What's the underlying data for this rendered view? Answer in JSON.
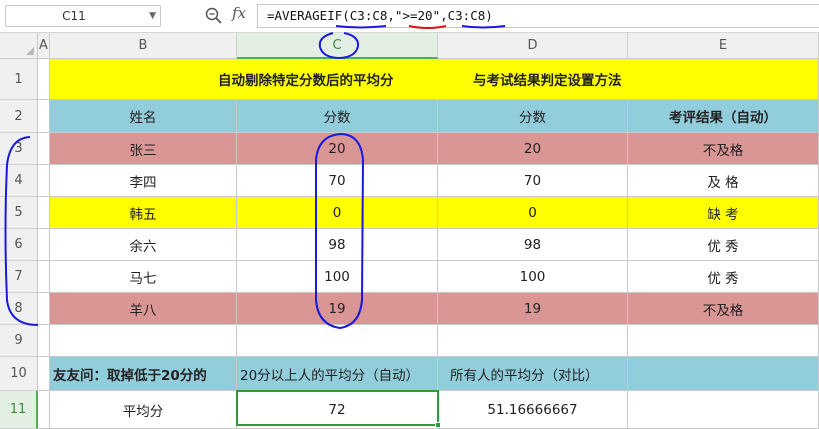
{
  "name_box": {
    "value": "C11"
  },
  "formula_bar": {
    "fx_label": "fx",
    "formula": "=AVERAGEIF(C3:C8,\">=20\",C3:C8)"
  },
  "columns": [
    "A",
    "B",
    "C",
    "D",
    "E"
  ],
  "rows": [
    "1",
    "2",
    "3",
    "4",
    "5",
    "6",
    "7",
    "8",
    "9",
    "10",
    "11"
  ],
  "sheet": {
    "title_left": "自动剔除特定分数后的平均分",
    "title_right": "与考试结果判定设置方法",
    "headers": [
      "姓名",
      "分数",
      "分数",
      "考评结果（自动）"
    ],
    "records": [
      {
        "name": "张三",
        "score": "20",
        "score2": "20",
        "result": "不及格"
      },
      {
        "name": "李四",
        "score": "70",
        "score2": "70",
        "result": "及 格"
      },
      {
        "name": "韩五",
        "score": "0",
        "score2": "0",
        "result": "缺 考"
      },
      {
        "name": "余六",
        "score": "98",
        "score2": "98",
        "result": "优 秀"
      },
      {
        "name": "马七",
        "score": "100",
        "score2": "100",
        "result": "优 秀"
      },
      {
        "name": "羊八",
        "score": "19",
        "score2": "19",
        "result": "不及格"
      }
    ],
    "row10": {
      "b": "友友问：取掉低于20分的",
      "c": "20分以上人的平均分（自动）",
      "d": "所有人的平均分（对比）",
      "e": ""
    },
    "row11": {
      "b": "平均分",
      "c": "72",
      "d": "51.16666667",
      "e": ""
    }
  },
  "colors": {
    "title_fill": "#ffff00",
    "header_fill": "#92cddc",
    "fail_fill": "#da9694",
    "absent_fill": "#ffff00",
    "selection": "#2e9a3c",
    "annotation_blue": "#1a1adf",
    "annotation_red": "#e01010"
  }
}
